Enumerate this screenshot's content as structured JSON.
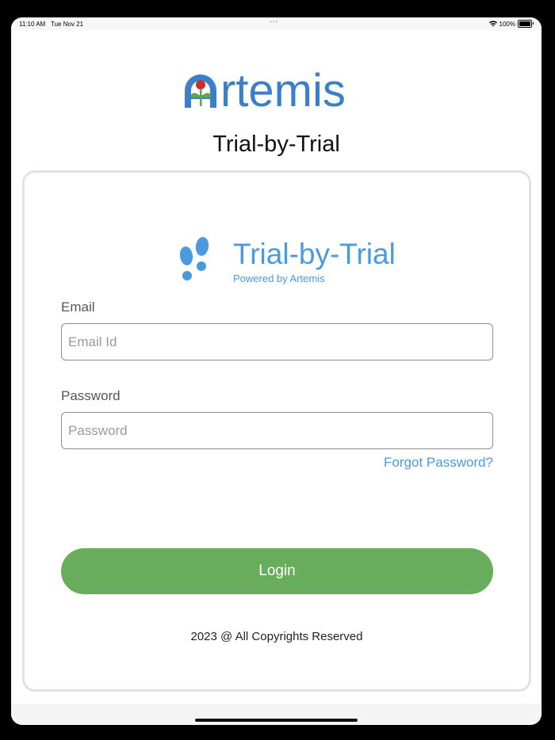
{
  "status_bar": {
    "time": "11:10 AM",
    "date": "Tue Nov 21",
    "battery": "100%",
    "wifi_icon": "wifi-icon",
    "battery_icon": "battery-icon"
  },
  "logo": {
    "text": "Artemis",
    "brand_color": "#3a7fc8",
    "accent_red": "#c9302c",
    "accent_green": "#5aa846"
  },
  "header": {
    "title": "Trial-by-Trial"
  },
  "card": {
    "brand_name": "Trial-by-Trial",
    "brand_tagline": "Powered by Artemis",
    "brand_icon": "footprints-icon",
    "email": {
      "label": "Email",
      "placeholder": "Email Id",
      "value": ""
    },
    "password": {
      "label": "Password",
      "placeholder": "Password",
      "value": ""
    },
    "forgot_password_label": "Forgot Password?",
    "login_label": "Login",
    "copyright": "2023 @ All Copyrights Reserved"
  },
  "colors": {
    "accent_blue": "#4a9ae0",
    "login_green": "#68ad5c",
    "card_border": "#e2e2e2"
  }
}
